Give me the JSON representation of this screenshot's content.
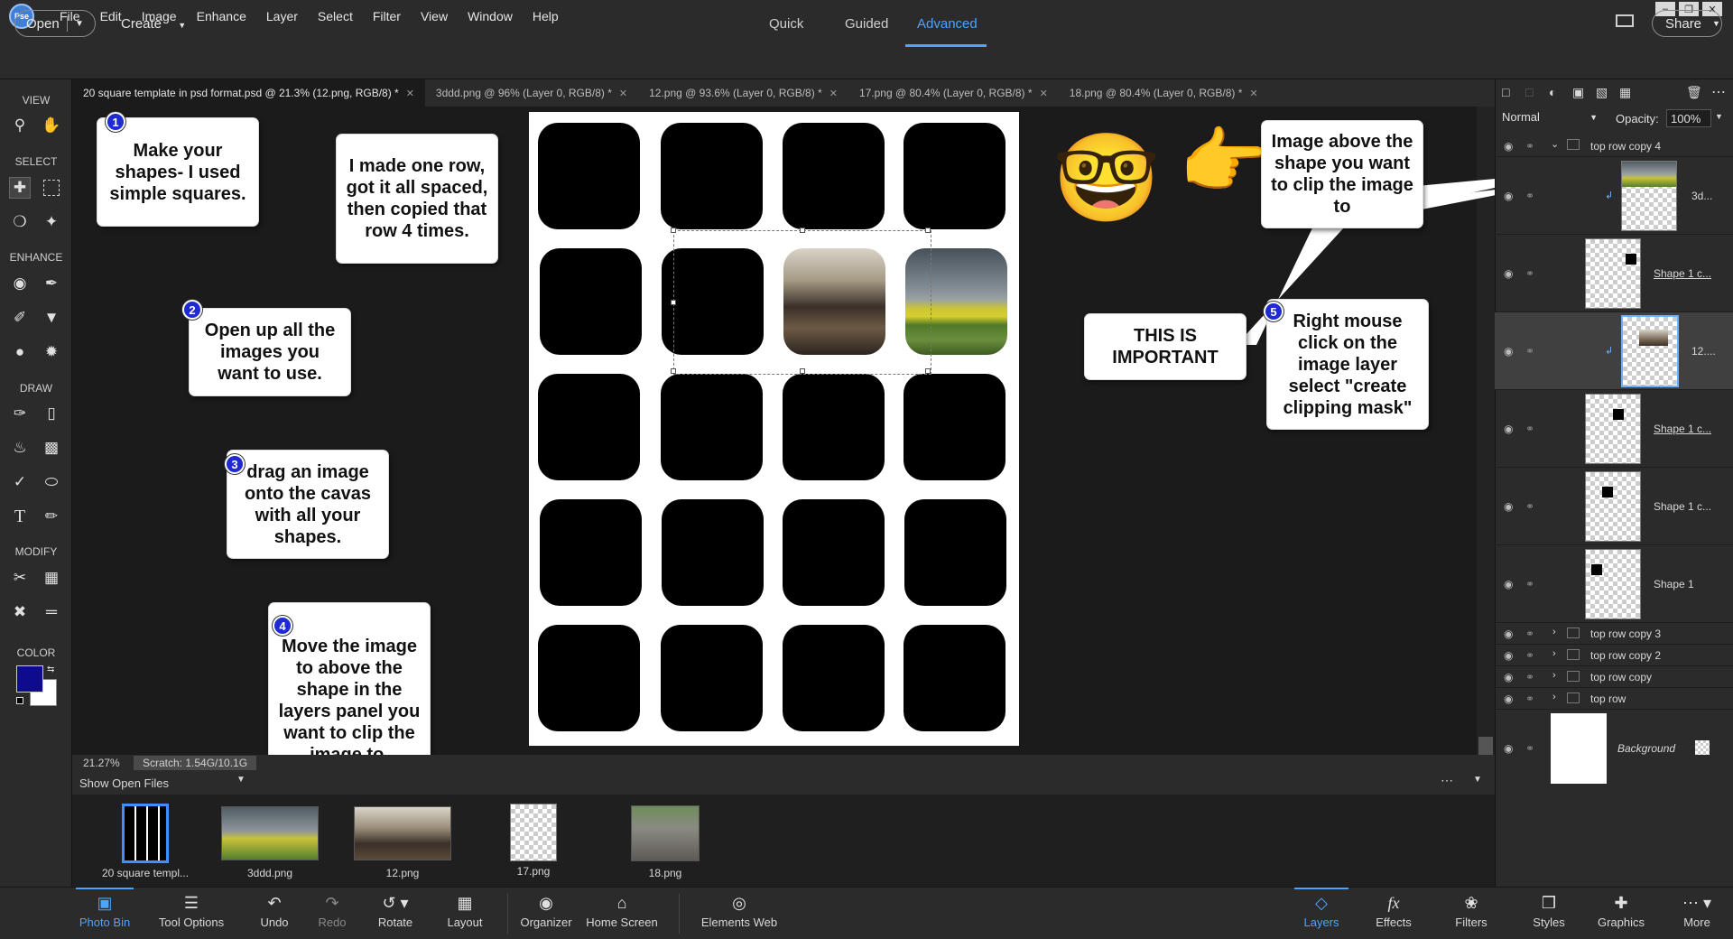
{
  "menubar": {
    "logo": "Pse",
    "items": [
      "File",
      "Edit",
      "Image",
      "Enhance",
      "Layer",
      "Select",
      "Filter",
      "View",
      "Window",
      "Help"
    ]
  },
  "toolbar": {
    "open_label": "Open",
    "create_label": "Create",
    "modes": [
      "Quick",
      "Guided",
      "Advanced"
    ],
    "share_label": "Share"
  },
  "tools": {
    "sections": [
      "VIEW",
      "SELECT",
      "ENHANCE",
      "DRAW",
      "MODIFY",
      "COLOR"
    ]
  },
  "doc_tabs": [
    {
      "label": "20 square template in psd format.psd @ 21.3% (12.png, RGB/8) *"
    },
    {
      "label": "3ddd.png @ 96% (Layer 0, RGB/8) *"
    },
    {
      "label": "12.png @ 93.6% (Layer 0, RGB/8) *"
    },
    {
      "label": "17.png @ 80.4% (Layer 0, RGB/8) *"
    },
    {
      "label": "18.png @ 80.4% (Layer 0, RGB/8) *"
    }
  ],
  "callouts": {
    "c1": {
      "num": "1",
      "text": "Make your shapes-  I used simple squares."
    },
    "c_row": {
      "text": "I made one row, got it all spaced, then copied that row 4 times."
    },
    "c2": {
      "num": "2",
      "text": "Open up all the images you want to use."
    },
    "c3": {
      "num": "3",
      "text": "drag an image onto the cavas with all your shapes."
    },
    "c4": {
      "num": "4",
      "text": "Move the image to above the shape in the layers panel you want to clip the image to."
    },
    "c_above": {
      "text": "Image above the shape you want to clip the image to"
    },
    "c_important": {
      "text": "THIS IS IMPORTANT"
    },
    "c5": {
      "num": "5",
      "text": "Right mouse click on the image layer select \"create clipping mask\""
    }
  },
  "emoji": {
    "nerd": "🤓",
    "point": "👉"
  },
  "status": {
    "zoom": "21.27%",
    "scratch": "Scratch: 1.54G/10.1G"
  },
  "bin": {
    "dropdown_label": "Show Open Files",
    "thumbs": [
      {
        "label": "20 square templ..."
      },
      {
        "label": "3ddd.png"
      },
      {
        "label": "12.png"
      },
      {
        "label": "17.png"
      },
      {
        "label": "18.png"
      }
    ]
  },
  "taskbar": {
    "left": [
      "Photo Bin",
      "Tool Options",
      "Undo",
      "Redo",
      "Rotate",
      "Layout",
      "Organizer",
      "Home Screen",
      "Elements Web"
    ],
    "right": [
      "Layers",
      "Effects",
      "Filters",
      "Styles",
      "Graphics",
      "More"
    ]
  },
  "layers": {
    "blend_mode": "Normal",
    "opacity_label": "Opacity:",
    "opacity_value": "100%",
    "rows": [
      {
        "name": "top row copy 4"
      },
      {
        "name": "3d..."
      },
      {
        "name": "Shape 1 c..."
      },
      {
        "name": "12...."
      },
      {
        "name": "Shape 1 c..."
      },
      {
        "name": "Shape 1 c..."
      },
      {
        "name": "Shape 1"
      },
      {
        "name": "top row copy 3"
      },
      {
        "name": "top row copy 2"
      },
      {
        "name": "top row copy"
      },
      {
        "name": "top row"
      },
      {
        "name": "Background"
      }
    ]
  },
  "colors": {
    "accent": "#4da3ff",
    "foreground": "#0e0b8e",
    "background": "#ffffff"
  }
}
